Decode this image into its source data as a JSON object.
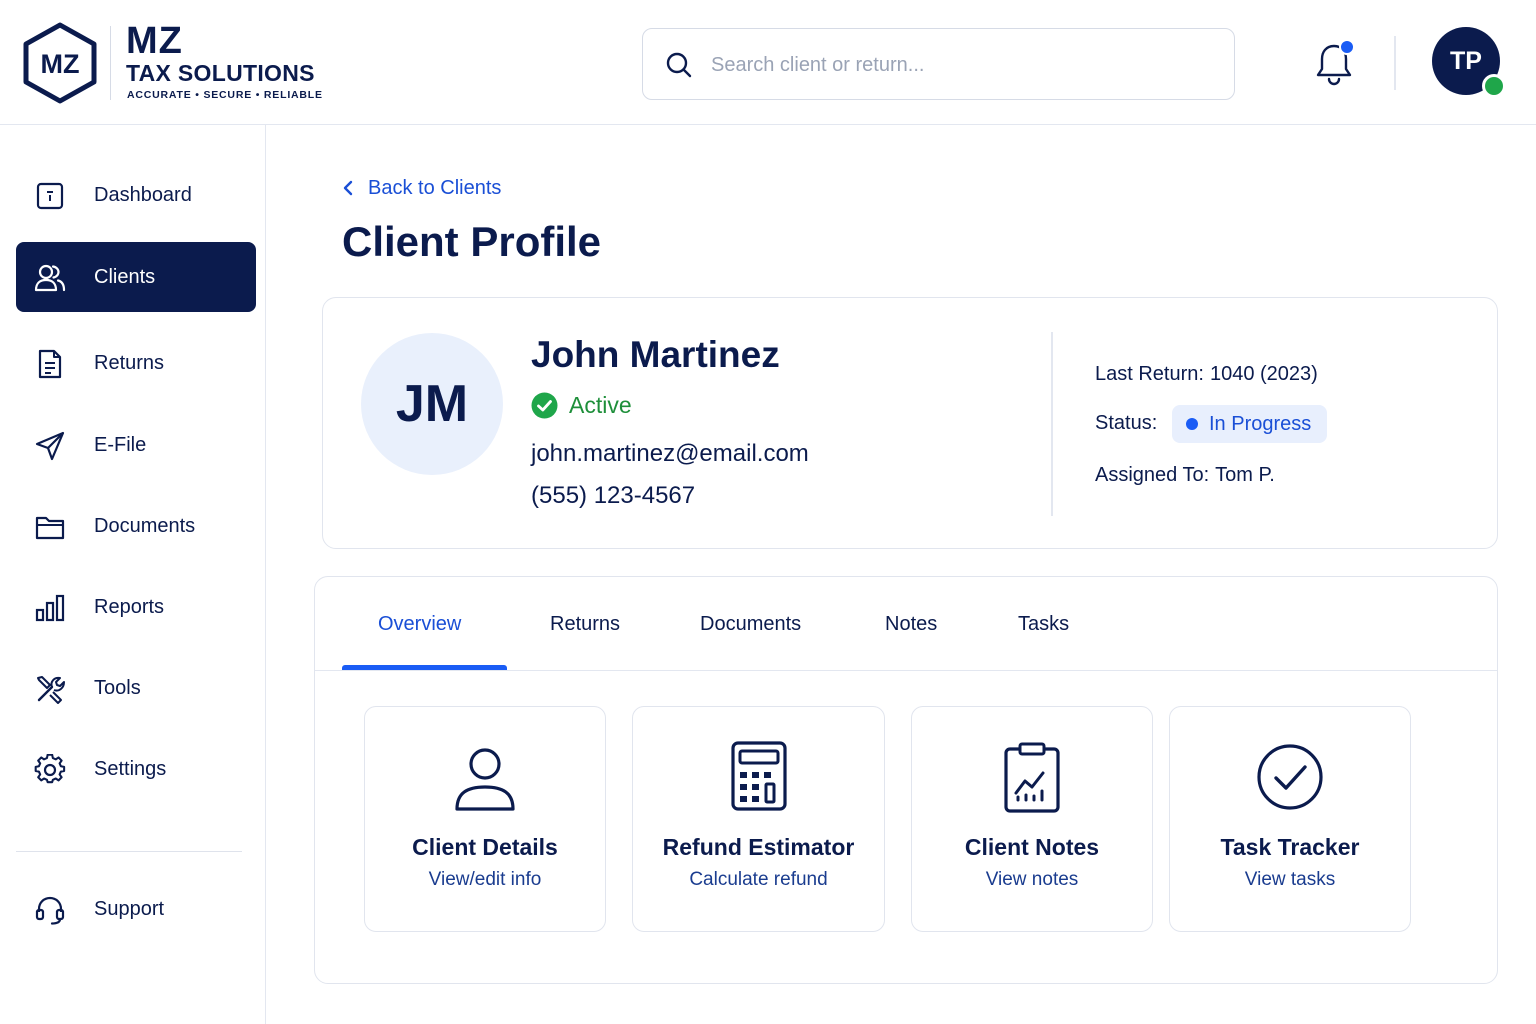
{
  "brand": {
    "mark": "MZ",
    "name_top": "MZ",
    "name_bottom": "TAX SOLUTIONS",
    "tagline": "ACCURATE • SECURE • RELIABLE"
  },
  "search": {
    "placeholder": "Search client or return...",
    "value": ""
  },
  "user": {
    "initials": "TP",
    "online": true
  },
  "notifications": {
    "has_unread": true
  },
  "sidebar": {
    "items": [
      {
        "label": "Dashboard",
        "icon": "dashboard-icon",
        "active": false
      },
      {
        "label": "Clients",
        "icon": "users-icon",
        "active": true
      },
      {
        "label": "Returns",
        "icon": "document-icon",
        "active": false
      },
      {
        "label": "E-File",
        "icon": "send-icon",
        "active": false
      },
      {
        "label": "Documents",
        "icon": "folder-icon",
        "active": false
      },
      {
        "label": "Reports",
        "icon": "bar-chart-icon",
        "active": false
      },
      {
        "label": "Tools",
        "icon": "tools-icon",
        "active": false
      },
      {
        "label": "Settings",
        "icon": "gear-icon",
        "active": false
      }
    ],
    "support": {
      "label": "Support",
      "icon": "headset-icon"
    }
  },
  "main": {
    "back_label": "Back to Clients",
    "title": "Client Profile"
  },
  "client": {
    "initials": "JM",
    "name": "John Martinez",
    "status": "Active",
    "email": "john.martinez@email.com",
    "phone": "(555) 123-4567",
    "last_return_label": "Last Return:",
    "last_return_value": "1040 (2023)",
    "status_label": "Status:",
    "return_status": "In Progress",
    "assigned_label": "Assigned To:",
    "assigned_value": "Tom P."
  },
  "tabs": [
    {
      "label": "Overview",
      "active": true
    },
    {
      "label": "Returns",
      "active": false
    },
    {
      "label": "Documents",
      "active": false
    },
    {
      "label": "Notes",
      "active": false
    },
    {
      "label": "Tasks",
      "active": false
    }
  ],
  "tiles": [
    {
      "title": "Client Details",
      "subtitle": "View/edit info",
      "icon": "person-icon"
    },
    {
      "title": "Refund Estimator",
      "subtitle": "Calculate refund",
      "icon": "calculator-icon"
    },
    {
      "title": "Client Notes",
      "subtitle": "View notes",
      "icon": "clipboard-chart-icon"
    },
    {
      "title": "Task Tracker",
      "subtitle": "View tasks",
      "icon": "check-circle-icon"
    }
  ],
  "colors": {
    "navy": "#0b1b4d",
    "accent_blue": "#1a5cf5",
    "link_blue": "#1a4fd6",
    "success_green": "#1e8f3a",
    "pill_bg": "#e8effd",
    "avatar_bg": "#e9f0fc"
  }
}
